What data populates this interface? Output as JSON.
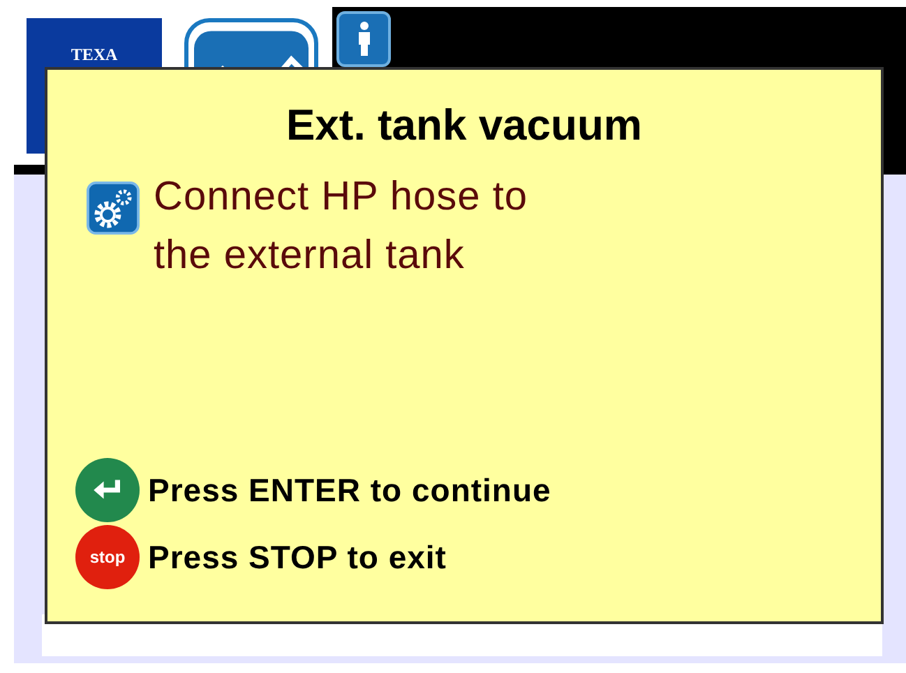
{
  "header": {
    "logo": "TEXA"
  },
  "dialog": {
    "title": "Ext. tank vacuum",
    "message": [
      "Connect HP hose to",
      "the external tank"
    ],
    "actions": [
      {
        "kind": "enter",
        "label": "Press ENTER to continue"
      },
      {
        "kind": "stop",
        "icon_text": "stop",
        "label": "Press STOP to exit"
      }
    ]
  }
}
